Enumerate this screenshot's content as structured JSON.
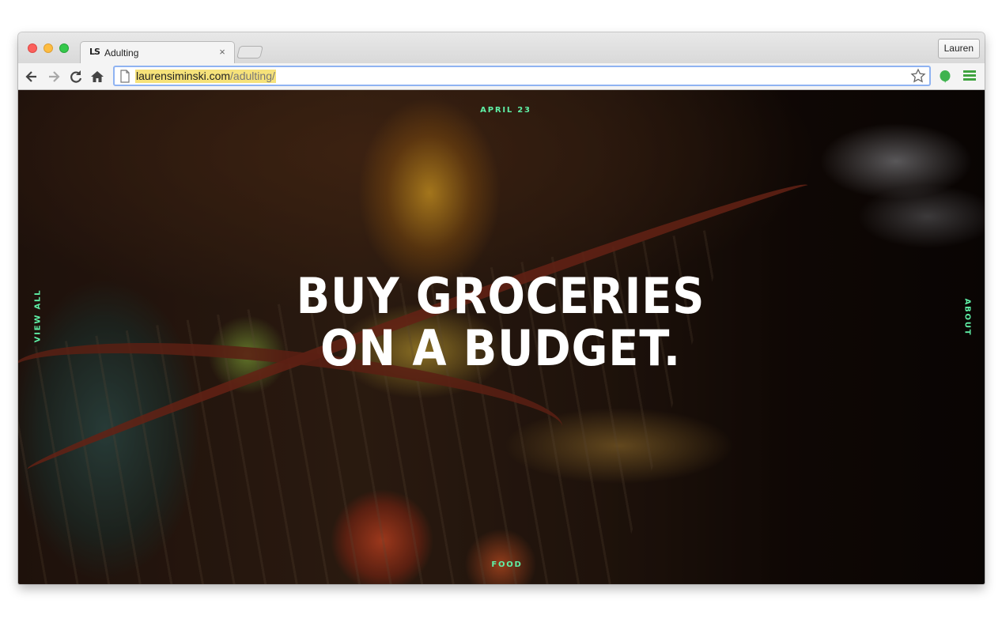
{
  "browser": {
    "tab": {
      "title": "Adulting",
      "favicon_text": "LS",
      "close_glyph": "×"
    },
    "profile_label": "Lauren",
    "omnibox": {
      "url_domain": "laurensiminski.com",
      "url_path": "/adulting/"
    },
    "icons": {
      "back": "back-arrow-icon",
      "forward": "forward-arrow-icon",
      "reload": "reload-icon",
      "home": "home-icon",
      "page": "page-icon",
      "bookmark": "star-icon",
      "extension": "evernote-icon",
      "menu": "hamburger-menu-icon"
    }
  },
  "hero": {
    "date": "APRIL 23",
    "title": "BUY GROCERIES ON A BUDGET.",
    "category": "FOOD",
    "left_link": "VIEW ALL",
    "right_link": "ABOUT",
    "accent_color": "#5ff0a6"
  }
}
